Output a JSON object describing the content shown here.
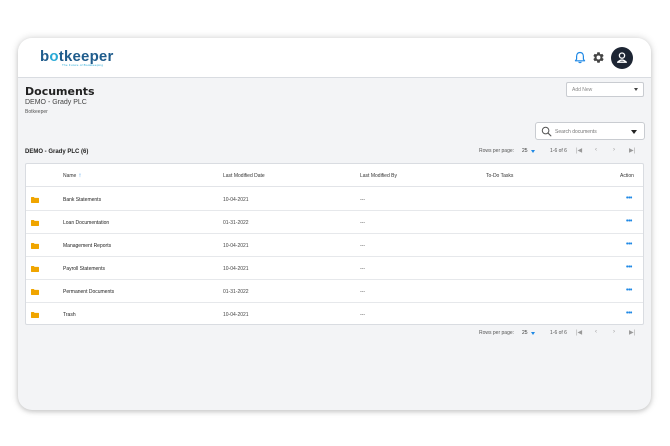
{
  "header": {
    "logo_prefix": "b",
    "logo_o": "o",
    "logo_suffix": "tkeeper",
    "logo_tagline": "The Future of Bookkeeping"
  },
  "page": {
    "title": "Documents",
    "client_name": "DEMO - Grady PLC",
    "company": "Botkeeper"
  },
  "add_new": {
    "label": "Add New"
  },
  "search": {
    "placeholder": "Search documents"
  },
  "section": {
    "title": "DEMO - Grady PLC (6)"
  },
  "pagination": {
    "rows_per_page_label": "Rows per page:",
    "rows_per_page_value": "25",
    "range": "1-6 of 6",
    "first": "|◀",
    "prev": "‹",
    "next": "›",
    "last": "▶|"
  },
  "table": {
    "columns": {
      "name": "Name",
      "modified_date": "Last Modified Date",
      "modified_by": "Last Modified By",
      "todo": "To-Do Tasks",
      "action": "Action"
    },
    "rows": [
      {
        "name": "Bank Statements",
        "date": "10-04-2021",
        "by": "---",
        "action": "•••"
      },
      {
        "name": "Loan Documentation",
        "date": "01-31-2022",
        "by": "---",
        "action": "•••"
      },
      {
        "name": "Management Reports",
        "date": "10-04-2021",
        "by": "---",
        "action": "•••"
      },
      {
        "name": "Payroll Statements",
        "date": "10-04-2021",
        "by": "---",
        "action": "•••"
      },
      {
        "name": "Permanent Documents",
        "date": "01-31-2022",
        "by": "---",
        "action": "•••"
      },
      {
        "name": "Trash",
        "date": "10-04-2021",
        "by": "---",
        "action": "•••"
      }
    ]
  },
  "colors": {
    "accent": "#1e88e5",
    "folder": "#f0a500",
    "brand_dark": "#1f5c8c",
    "brand_light": "#29a9d6",
    "avatar_bg": "#1d2533"
  },
  "icons": {
    "bell": "bell-icon",
    "gear": "gear-icon",
    "avatar": "user-icon",
    "search": "search-icon",
    "folder": "folder-icon"
  }
}
